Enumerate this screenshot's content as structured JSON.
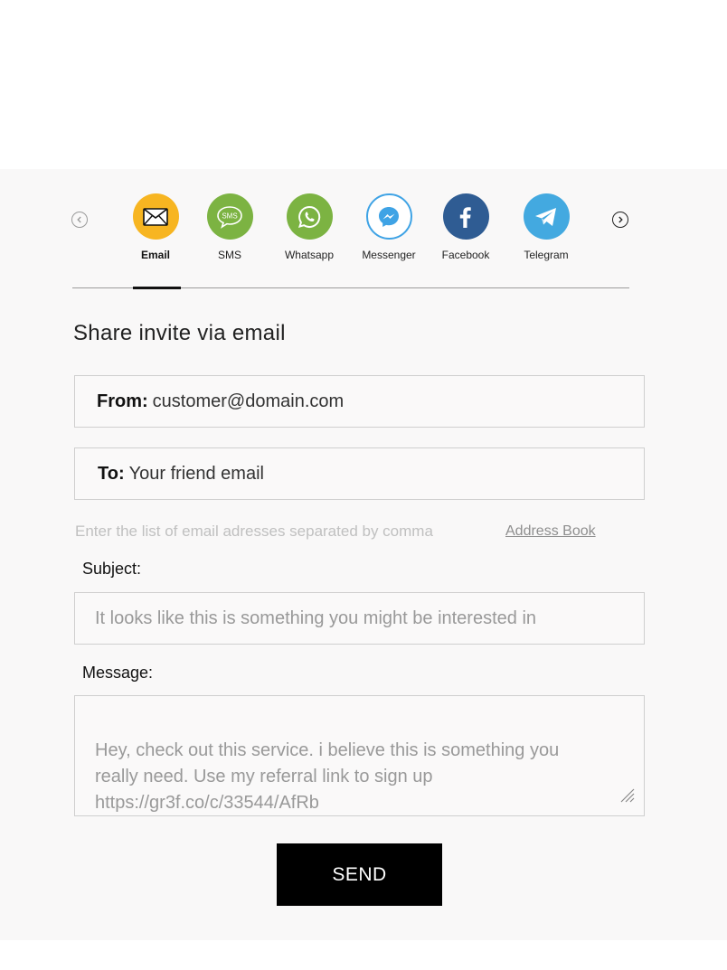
{
  "channels": [
    {
      "label": "Email",
      "icon": "envelope-icon",
      "color": "#f7b521",
      "active": true
    },
    {
      "label": "SMS",
      "icon": "sms-bubble-icon",
      "color": "#7cb342"
    },
    {
      "label": "Whatsapp",
      "icon": "whatsapp-icon",
      "color": "#7cb342"
    },
    {
      "label": "Messenger",
      "icon": "messenger-icon",
      "color": "#ffffff"
    },
    {
      "label": "Facebook",
      "icon": "facebook-icon",
      "color": "#2f5c93"
    },
    {
      "label": "Telegram",
      "icon": "telegram-icon",
      "color": "#43a9e0"
    }
  ],
  "sms_icon_text": "SMS",
  "heading": "Share invite via email",
  "from": {
    "label": "From:",
    "value": "customer@domain.com"
  },
  "to": {
    "label": "To:",
    "placeholder": "Your friend email"
  },
  "hint": "Enter the list of email adresses separated by comma",
  "address_book": "Address Book",
  "subject": {
    "label": "Subject:",
    "value": "It looks like this is something you might be interested in"
  },
  "message": {
    "label": "Message:",
    "value": "Hey, check out this service. i believe this is something you\nreally need. Use my referral link to sign up\nhttps://gr3f.co/c/33544/AfRb"
  },
  "send_label": "SEND"
}
